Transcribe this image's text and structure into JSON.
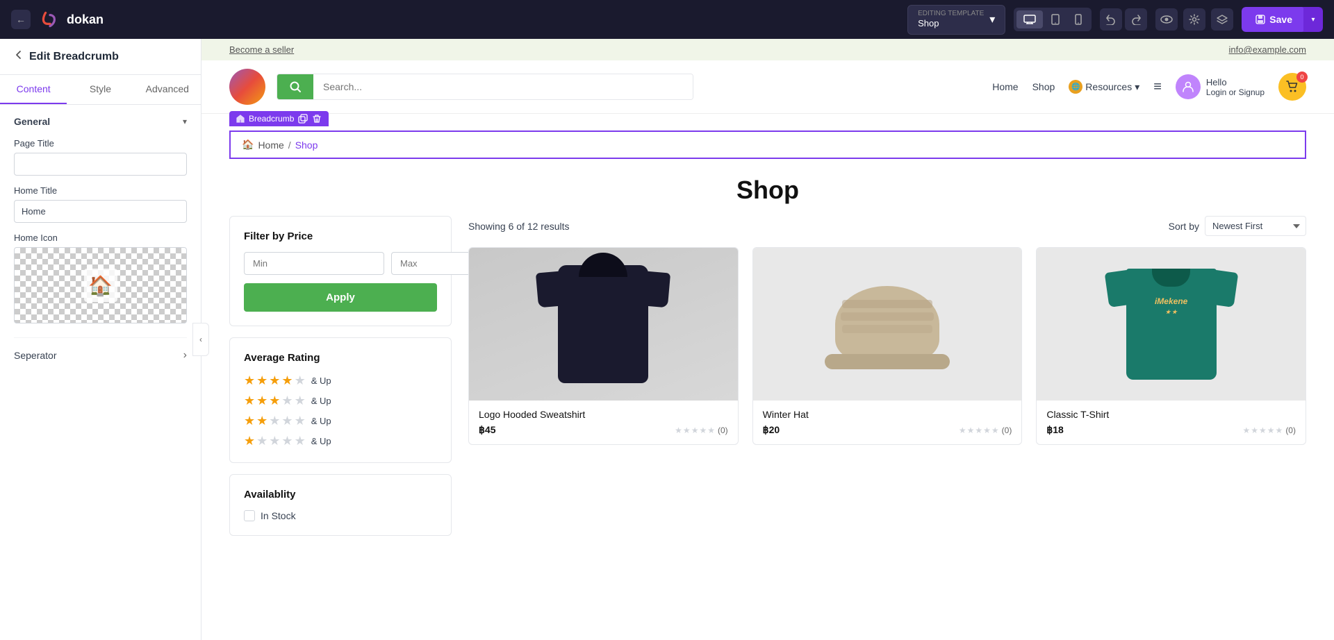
{
  "toolbar": {
    "back_label": "←",
    "logo_text": "dokan",
    "template_label": "EDITING TEMPLATE",
    "template_value": "Shop",
    "device_desktop": "🖥",
    "device_tablet": "⬜",
    "device_mobile": "📱",
    "undo": "↺",
    "redo": "↻",
    "preview_icon": "👁",
    "settings_icon": "⚙",
    "layers_icon": "◧",
    "save_label": "Save",
    "save_dropdown": "▾"
  },
  "announcement": {
    "seller_link": "Become a seller",
    "email": "info@example.com"
  },
  "header": {
    "search_placeholder": "Search...",
    "nav_home": "Home",
    "nav_shop": "Shop",
    "nav_resources": "Resources",
    "nav_resources_icon": "🌐",
    "hamburger": "≡",
    "hello_text": "Hello",
    "login_text": "Login or Signup",
    "cart_count": "0"
  },
  "breadcrumb": {
    "toolbar_label": "Breadcrumb",
    "home_icon": "🏠",
    "home_text": "Home",
    "separator": "/",
    "current": "Shop"
  },
  "shop": {
    "title": "Shop",
    "results_text": "Showing 6 of 12 results",
    "sort_label": "Sort by",
    "sort_value": "Newest First"
  },
  "sidebar_panel": {
    "back_icon": "←",
    "title": "Edit Breadcrumb",
    "tabs": [
      "Content",
      "Style",
      "Advanced"
    ],
    "active_tab": 0,
    "general_label": "General",
    "page_title_label": "Page Title",
    "page_title_value": "",
    "home_title_label": "Home Title",
    "home_title_value": "Home",
    "home_icon_label": "Home Icon",
    "separator_label": "Seperator"
  },
  "filter": {
    "title": "Filter by Price",
    "min_placeholder": "Min",
    "max_placeholder": "Max",
    "apply_label": "Apply",
    "rating_title": "Average Rating",
    "ratings": [
      {
        "filled": 4,
        "empty": 1,
        "label": "& Up"
      },
      {
        "filled": 3,
        "empty": 2,
        "label": "& Up"
      },
      {
        "filled": 2,
        "empty": 3,
        "label": "& Up"
      },
      {
        "filled": 1,
        "empty": 4,
        "label": "& Up"
      }
    ],
    "availability_title": "Availablity",
    "in_stock": "In Stock"
  },
  "products": [
    {
      "name": "Logo Hooded Sweatshirt",
      "price": "฿45",
      "rating_count": "(0)",
      "type": "hoodie"
    },
    {
      "name": "Winter Hat",
      "price": "฿20",
      "rating_count": "(0)",
      "type": "hat"
    },
    {
      "name": "Classic T-Shirt",
      "price": "฿18",
      "rating_count": "(0)",
      "type": "tshirt"
    }
  ]
}
